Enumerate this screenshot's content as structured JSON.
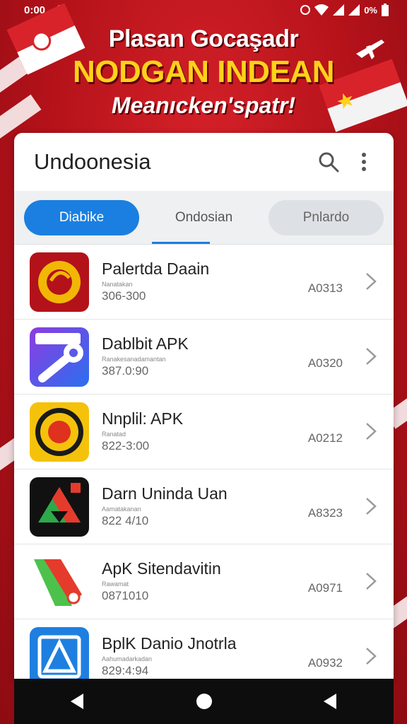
{
  "status": {
    "time": "0:00",
    "battery": "0%"
  },
  "banner": {
    "line1": "Plasan Gocaşadr",
    "line2": "NODGAN INDEAN",
    "line3": "Meanıcken'spatr!"
  },
  "appbar": {
    "title": "Undoonesia",
    "search_icon": "search-icon",
    "menu_icon": "more-vert-icon"
  },
  "tabs": [
    {
      "label": "Diabike"
    },
    {
      "label": "Ondosian"
    },
    {
      "label": "Pnlardo"
    }
  ],
  "apps": [
    {
      "name": "Palertda Daain",
      "sub": "Nanatakan",
      "size": "306-300",
      "version": "A0313"
    },
    {
      "name": "Dablbit APK",
      "sub": "Ranakesanadamantan",
      "size": "387.0:90",
      "version": "A0320"
    },
    {
      "name": "Nnplil: APK",
      "sub": "Ranatad",
      "size": "822-3:00",
      "version": "A0212"
    },
    {
      "name": "Darn Uninda Uan",
      "sub": "Aamatakanan",
      "size": "822 4/10",
      "version": "A8323"
    },
    {
      "name": "ApK Sitendavitin",
      "sub": "Rawamat",
      "size": "0871010",
      "version": "A0971"
    },
    {
      "name": "BplK Danio Jnotrla",
      "sub": "Aahumadarkadan",
      "size": "829:4:94",
      "version": "A0932"
    }
  ],
  "colors": {
    "accent": "#1a7fe0",
    "banner_red": "#c8161e",
    "banner_yellow": "#ffd21a"
  }
}
